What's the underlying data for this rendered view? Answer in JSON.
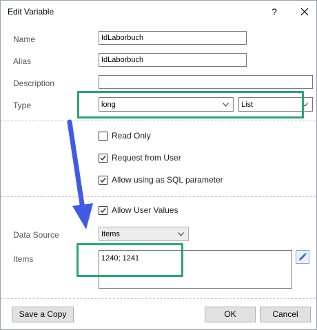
{
  "window": {
    "title": "Edit Variable",
    "help": "?"
  },
  "fields": {
    "name": {
      "label": "Name",
      "value": "IdLaborbuch"
    },
    "alias": {
      "label": "Alias",
      "value": "IdLaborbuch"
    },
    "description": {
      "label": "Description",
      "value": ""
    },
    "type": {
      "label": "Type",
      "value": "long",
      "kind": "List"
    }
  },
  "options": {
    "read_only": {
      "label": "Read Only",
      "checked": false
    },
    "request_from_user": {
      "label": "Request from User",
      "checked": true
    },
    "allow_sql_param": {
      "label": "Allow using as SQL parameter",
      "checked": true
    },
    "allow_user_values": {
      "label": "Allow User Values",
      "checked": true
    }
  },
  "data_source": {
    "label": "Data Source",
    "value": "Items"
  },
  "items": {
    "label": "Items",
    "value": "1240; 1241"
  },
  "buttons": {
    "save_copy": "Save a Copy",
    "ok": "OK",
    "cancel": "Cancel"
  },
  "colors": {
    "highlight": "#2aa37a",
    "arrow": "#3f5be6"
  }
}
